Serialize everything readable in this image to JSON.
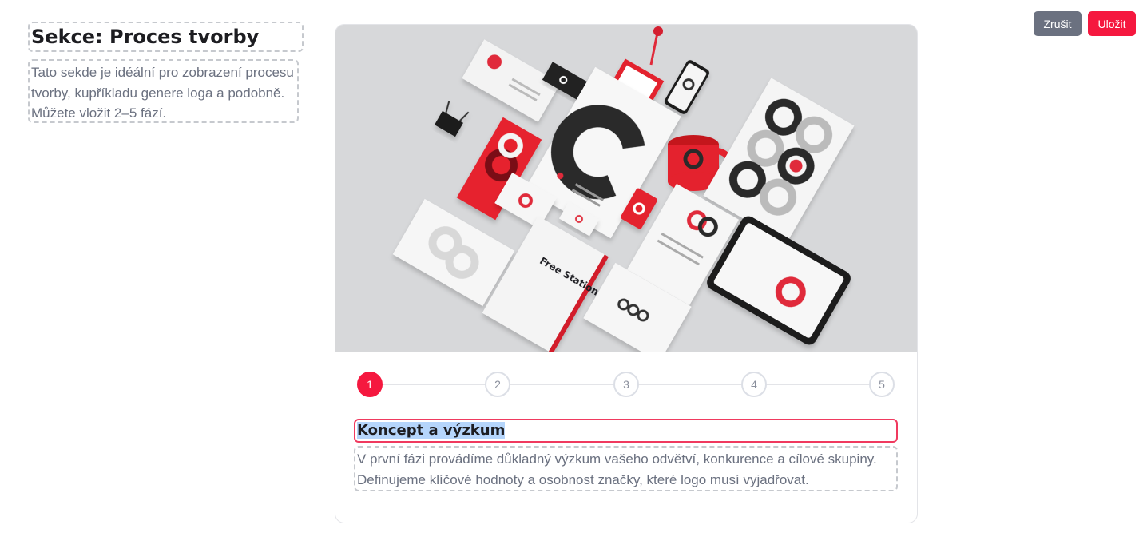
{
  "actions": {
    "cancel_label": "Zrušit",
    "save_label": "Uložit"
  },
  "section": {
    "title": "Sekce: Proces tvorby",
    "description": "Tato sekde je idéální pro zobrazení procesu tvorby, kupříkladu genere loga a podobně. Můžete vložit 2–5 fází."
  },
  "image": {
    "poster_text": "Free Stationery Mockup"
  },
  "stepper": {
    "steps": [
      "1",
      "2",
      "3",
      "4",
      "5"
    ],
    "active_step": "1"
  },
  "step_content": {
    "title": "Koncept a výzkum",
    "description": "V první fázi provádíme důkladný výzkum vašeho odvětví, konkurence a cílové skupiny. Definujeme klíčové hodnoty a osobnost značky, které logo musí vyjadřovat."
  },
  "colors": {
    "accent": "#f5183f",
    "secondary_button": "#6b7180",
    "muted_text": "#6b7180"
  }
}
